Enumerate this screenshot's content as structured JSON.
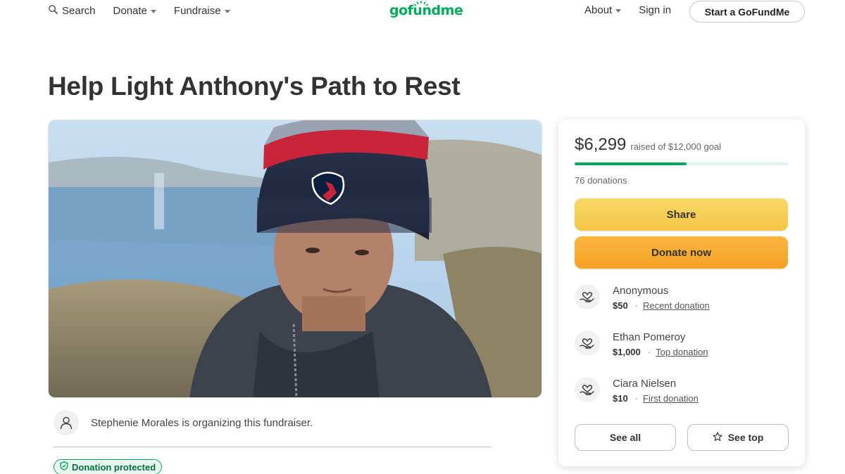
{
  "header": {
    "search_label": "Search",
    "donate_label": "Donate",
    "fundraise_label": "Fundraise",
    "logo_text": "gofundme",
    "about_label": "About",
    "signin_label": "Sign in",
    "start_label": "Start a GoFundMe"
  },
  "campaign": {
    "title": "Help Light Anthony's Path to Rest",
    "organizer_text": "Stephenie Morales is organizing this fundraiser.",
    "protected_label": "Donation protected"
  },
  "progress": {
    "raised": "$6,299",
    "goal_text": "raised of $12,000 goal",
    "donation_count": "76 donations",
    "fraction": 0.525
  },
  "actions": {
    "share_label": "Share",
    "donate_label": "Donate now",
    "see_all_label": "See all",
    "see_top_label": "See top"
  },
  "donations": [
    {
      "name": "Anonymous",
      "amount": "$50",
      "tag": "Recent donation"
    },
    {
      "name": "Ethan Pomeroy",
      "amount": "$1,000",
      "tag": "Top donation"
    },
    {
      "name": "Ciara Nielsen",
      "amount": "$10",
      "tag": "First donation"
    }
  ],
  "colors": {
    "brand": "#02a95c",
    "share_button": "#f4c542",
    "donate_button": "#f6a124"
  },
  "icons": {
    "search": "search-icon",
    "organizer": "user-icon",
    "protected": "shield-icon",
    "donor": "heart-hand-icon",
    "see_top": "star-icon"
  }
}
